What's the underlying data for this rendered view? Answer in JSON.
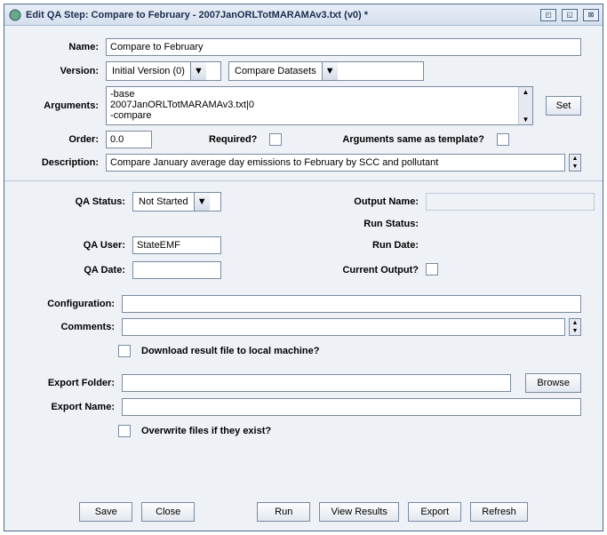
{
  "window": {
    "title": "Edit QA Step: Compare to February - 2007JanORLTotMARAMAv3.txt (v0) *"
  },
  "form": {
    "name_label": "Name:",
    "name_value": "Compare to February",
    "version_label": "Version:",
    "version_value": "Initial Version (0)",
    "program_value": "Compare Datasets",
    "arguments_label": "Arguments:",
    "arguments_text": "-base\n2007JanORLTotMARAMAv3.txt|0\n-compare",
    "set_btn": "Set",
    "order_label": "Order:",
    "order_value": "0.0",
    "required_label": "Required?",
    "args_same_label": "Arguments same as template?",
    "description_label": "Description:",
    "description_value": "Compare January average day emissions to February by SCC and pollutant"
  },
  "status": {
    "qa_status_label": "QA Status:",
    "qa_status_value": "Not Started",
    "qa_user_label": "QA User:",
    "qa_user_value": "StateEMF",
    "qa_date_label": "QA Date:",
    "qa_date_value": "",
    "output_name_label": "Output Name:",
    "output_name_value": "",
    "run_status_label": "Run Status:",
    "run_date_label": "Run Date:",
    "current_output_label": "Current Output?"
  },
  "lower": {
    "configuration_label": "Configuration:",
    "configuration_value": "",
    "comments_label": "Comments:",
    "comments_value": "",
    "download_label": "Download result file to local machine?",
    "export_folder_label": "Export Folder:",
    "export_folder_value": "",
    "browse_btn": "Browse",
    "export_name_label": "Export Name:",
    "export_name_value": "",
    "overwrite_label": "Overwrite files if they exist?"
  },
  "buttons": {
    "save": "Save",
    "close": "Close",
    "run": "Run",
    "view_results": "View Results",
    "export": "Export",
    "refresh": "Refresh"
  }
}
